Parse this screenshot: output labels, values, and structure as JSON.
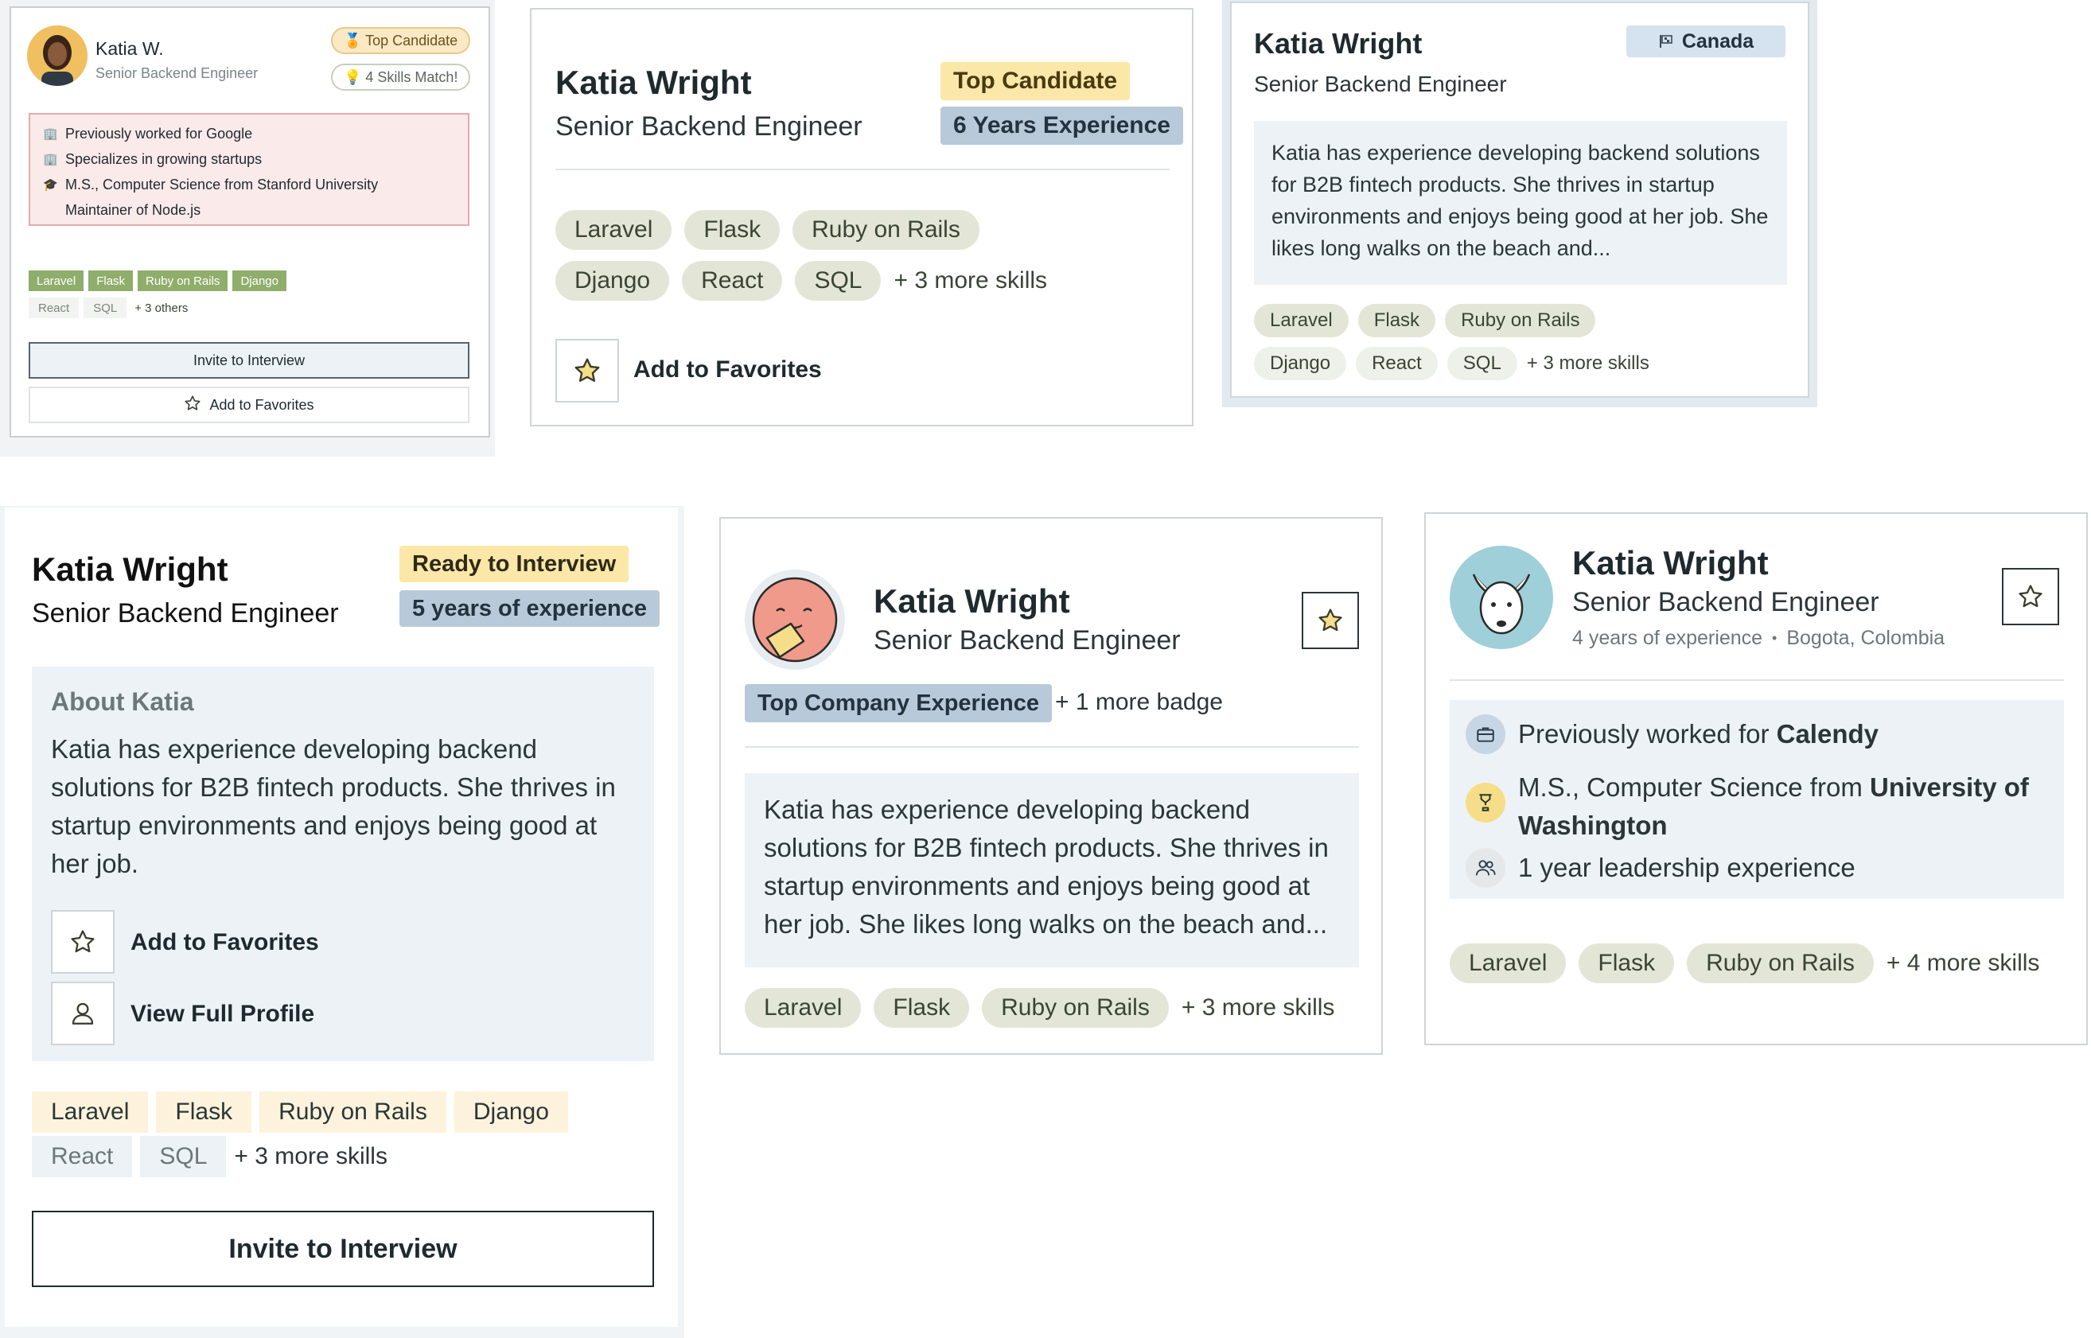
{
  "colors": {
    "skill_green": "#e3e6d6",
    "top_candidate_yellow": "#fbe7a8",
    "experience_blue": "#b8c9d9",
    "panel_blue": "#edf2f6",
    "highlight_pink": "#fbeaea",
    "small_skill_green": "#8fae6b",
    "star_gold": "#f2c94c"
  },
  "card1": {
    "name": "Katia W.",
    "title": "Senior Backend Engineer",
    "badges": [
      "🏅 Top Candidate",
      "💡 4 Skills Match!"
    ],
    "highlights": [
      {
        "icon": "🏢",
        "text": "Previously worked for Google"
      },
      {
        "icon": "🏢",
        "text": "Specializes in growing startups"
      },
      {
        "icon": "🎓",
        "text": "M.S., Computer Science from Stanford University"
      },
      {
        "icon": "",
        "text": "Maintainer of Node.js"
      }
    ],
    "skills_primary": [
      "Laravel",
      "Flask",
      "Ruby on Rails",
      "Django"
    ],
    "skills_secondary": [
      "React",
      "SQL"
    ],
    "more_skills": "+ 3 others",
    "invite_label": "Invite to Interview",
    "favorites_label": "Add to Favorites"
  },
  "card2": {
    "name": "Katia Wright",
    "title": "Senior Backend Engineer",
    "badge_top": "Top Candidate",
    "badge_exp": "6 Years Experience",
    "skills": [
      "Laravel",
      "Flask",
      "Ruby on Rails",
      "Django",
      "React",
      "SQL"
    ],
    "more_skills": "+ 3 more skills",
    "favorites_label": "Add to Favorites"
  },
  "card3": {
    "name": "Katia Wright",
    "title": "Senior Backend Engineer",
    "location_badge": "Canada",
    "bio": "Katia has experience developing backend solutions for B2B fintech products. She thrives in startup environments and enjoys being good at her job. She likes long walks on the beach and...",
    "skills": [
      "Laravel",
      "Flask",
      "Ruby on Rails",
      "Django",
      "React",
      "SQL"
    ],
    "more_skills": "+ 3 more skills"
  },
  "card4": {
    "name": "Katia Wright",
    "title": "Senior Backend Engineer",
    "badge_ready": "Ready to Interview",
    "badge_exp": "5 years of experience",
    "about_heading": "About Katia",
    "bio": "Katia has experience developing backend solutions for B2B fintech products. She thrives in startup environments and enjoys being good at her job.",
    "favorites_label": "Add to Favorites",
    "profile_label": "View Full Profile",
    "skills_primary": [
      "Laravel",
      "Flask",
      "Ruby on Rails",
      "Django"
    ],
    "skills_secondary": [
      "React",
      "SQL"
    ],
    "more_skills": "+ 3 more skills",
    "invite_label": "Invite to Interview"
  },
  "card5": {
    "name": "Katia Wright",
    "title": "Senior Backend Engineer",
    "badge": "Top Company Experience",
    "more_badge": "+ 1 more badge",
    "bio": "Katia has experience developing backend solutions for B2B fintech products. She thrives in startup environments and enjoys being good at her job. She likes long walks on the beach and...",
    "skills": [
      "Laravel",
      "Flask",
      "Ruby on Rails"
    ],
    "more_skills": "+ 3 more skills"
  },
  "card6": {
    "name": "Katia Wright",
    "title": "Senior Backend Engineer",
    "experience": "4 years of experience",
    "separator": "•",
    "location": "Bogota, Colombia",
    "facts": [
      {
        "prefix": "Previously worked for ",
        "bold": "Calendy"
      },
      {
        "prefix": "M.S., Computer Science from ",
        "bold": "University of Washington"
      },
      {
        "prefix": "1 year leadership experience",
        "bold": ""
      }
    ],
    "skills": [
      "Laravel",
      "Flask",
      "Ruby on Rails"
    ],
    "more_skills": "+ 4 more skills"
  }
}
